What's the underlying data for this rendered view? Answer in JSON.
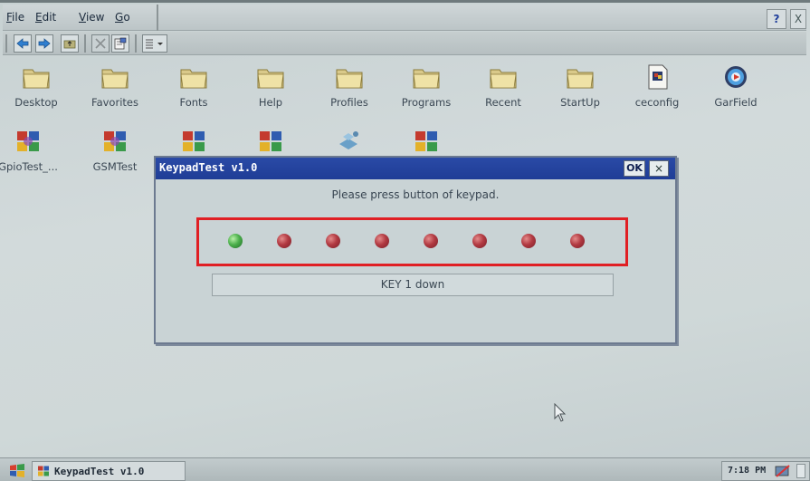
{
  "menu": {
    "file": "File",
    "edit": "Edit",
    "view": "View",
    "go": "Go",
    "help": "?",
    "close": "X"
  },
  "desktop_icons": [
    {
      "label": "Desktop",
      "icon": "folder-icon"
    },
    {
      "label": "Favorites",
      "icon": "folder-icon"
    },
    {
      "label": "Fonts",
      "icon": "folder-icon"
    },
    {
      "label": "Help",
      "icon": "folder-icon"
    },
    {
      "label": "Profiles",
      "icon": "folder-icon"
    },
    {
      "label": "Programs",
      "icon": "folder-icon"
    },
    {
      "label": "Recent",
      "icon": "folder-icon"
    },
    {
      "label": "StartUp",
      "icon": "folder-icon"
    },
    {
      "label": "ceconfig",
      "icon": "config-file-icon"
    },
    {
      "label": "GarField",
      "icon": "app-icon"
    },
    {
      "label": "GpioTest_...",
      "icon": "app-icon"
    },
    {
      "label": "GSMTest",
      "icon": "app-icon"
    }
  ],
  "dialog": {
    "title": "KeypadTest v1.0",
    "ok_label": "OK",
    "close_label": "×",
    "message": "Please press button of keypad.",
    "status": "KEY 1 down",
    "leds": [
      "green",
      "red",
      "red",
      "red",
      "red",
      "red",
      "red",
      "red"
    ],
    "colors": {
      "highlight": "#e01f24",
      "title_bar": "#1f3d96"
    }
  },
  "taskbar": {
    "task_label": "KeypadTest v1.0",
    "clock": "7:18 PM"
  }
}
